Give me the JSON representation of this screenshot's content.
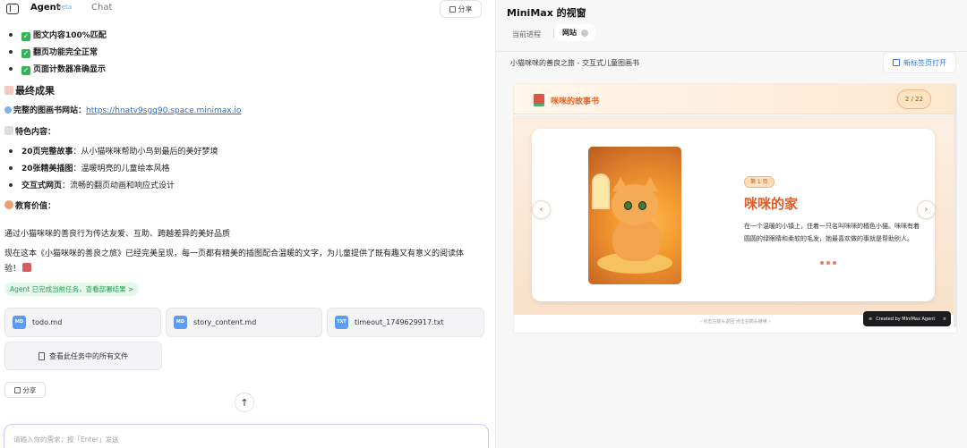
{
  "header": {
    "agent_tab": "Agent",
    "beta": "Beta",
    "chat_tab": "Chat",
    "share_label": "分享"
  },
  "checklist": [
    "图文内容100%匹配",
    "翻页功能完全正常",
    "页面计数器准确显示"
  ],
  "final": {
    "heading": "最终成果",
    "site_label": "完整的图画书网站：",
    "site_url": "https://hnatv9sgq90.space.minimax.io",
    "features_heading": "特色内容：",
    "features": [
      {
        "bold": "20页完整故事",
        "text": "：从小猫咪咪帮助小鸟到最后的美好梦境"
      },
      {
        "bold": "20张精美插图",
        "text": "：温暖明亮的儿童绘本风格"
      },
      {
        "bold": "交互式网页",
        "text": "：流畅的翻页动画和响应式设计"
      }
    ],
    "edu_heading": "教育价值：",
    "para1": "通过小猫咪咪的善良行为传达友爱、互助、跨越差异的美好品质",
    "para2a": "现在这本《小猫咪咪的善良之旅》已经完美呈现，每一页都有精美的插图配合温暖的文字，为儿童提供了既有趣又有意义的阅读体",
    "para2b": "验！"
  },
  "status_pill": "Agent 已完成当前任务，查看部署结果 >",
  "files": [
    {
      "name": "todo.md",
      "type": "MD"
    },
    {
      "name": "story_content.md",
      "type": "MD"
    },
    {
      "name": "timeout_1749629917.txt",
      "type": "TXT"
    }
  ],
  "all_files_label": "查看此任务中的所有文件",
  "share_bottom": "分享",
  "composer_placeholder": "请输入你的需求，按「Enter」发送",
  "right": {
    "title": "MiniMax 的视窗",
    "tab_process": "当前进程",
    "tab_site": "网站",
    "page_title": "小猫咪咪的善良之旅 - 交互式儿童图画书",
    "new_tab": "新标签页打开"
  },
  "book": {
    "title": "咪咪的故事书",
    "page_counter": "2 / 22",
    "badge": "第 1 页",
    "story_title": "咪咪的家",
    "story_text": "在一个温暖的小镇上，住着一只名叫咪咪的橘色小猫。咪咪有着圆圆的绿眼睛和柔软的毛发，她最喜欢做的事就是帮助别人。",
    "hint": "‹ 点击左箭头返回    点击右箭头继续 ›",
    "created_by": "Created by MiniMax Agent",
    "close": "×"
  },
  "colors": {
    "accent_orange": "#e05c24",
    "link_blue": "#1f6fd1",
    "success_green": "#34b458"
  }
}
